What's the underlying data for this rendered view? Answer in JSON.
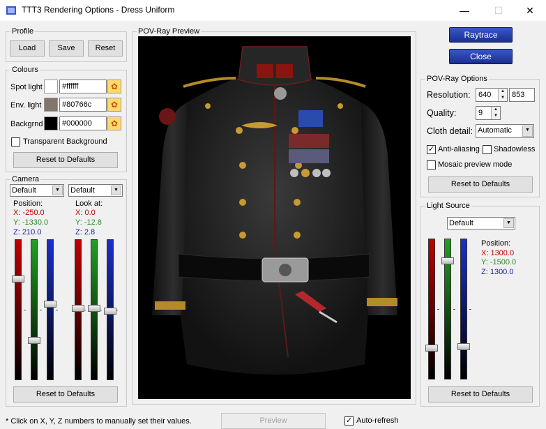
{
  "window": {
    "title": "TTT3 Rendering Options - Dress Uniform",
    "minimize": "—",
    "maximize": "☐",
    "close": "✕"
  },
  "profile": {
    "title": "Profile",
    "load": "Load",
    "save": "Save",
    "reset": "Reset"
  },
  "colours": {
    "title": "Colours",
    "rows": [
      {
        "label": "Spot light",
        "hex": "#ffffff",
        "color": "#ffffff"
      },
      {
        "label": "Env. light",
        "hex": "#80766c",
        "color": "#80766c"
      },
      {
        "label": "Backgrnd",
        "hex": "#000000",
        "color": "#000000"
      }
    ],
    "transparent_label": "Transparent Background",
    "reset": "Reset to Defaults"
  },
  "camera": {
    "title": "Camera",
    "preset1": "Default",
    "preset2": "Default",
    "position_label": "Position:",
    "look_label": "Look at:",
    "pos": {
      "x": "X:  -250.0",
      "y": "Y:  -1330.0",
      "z": "Z:  210.0"
    },
    "look": {
      "x": "X:  0.0",
      "y": "Y:  -12.8",
      "z": "Z:  2.8"
    },
    "reset": "Reset to Defaults"
  },
  "preview": {
    "title": "POV-Ray Preview"
  },
  "actions": {
    "raytrace": "Raytrace",
    "close": "Close"
  },
  "povray": {
    "title": "POV-Ray Options",
    "resolution_label": "Resolution:",
    "res_w": "640",
    "res_h": "853",
    "quality_label": "Quality:",
    "quality": "9",
    "cloth_label": "Cloth detail:",
    "cloth": "Automatic",
    "antialias": "Anti-aliasing",
    "shadowless": "Shadowless",
    "mosaic": "Mosaic preview mode",
    "reset": "Reset to Defaults"
  },
  "light": {
    "title": "Light Source",
    "preset": "Default",
    "position_label": "Position:",
    "x": "X:  1300.0",
    "y": "Y:  -1500.0",
    "z": "Z:  1300.0",
    "reset": "Reset to Defaults"
  },
  "footer": {
    "hint": "* Click on X, Y, Z numbers to manually set their values.",
    "preview": "Preview",
    "autorefresh": "Auto-refresh"
  },
  "sliders": {
    "camera_position": [
      0.27,
      0.73,
      0.46
    ],
    "camera_lookat": [
      0.49,
      0.49,
      0.51
    ],
    "light": [
      0.79,
      0.14,
      0.78
    ]
  },
  "colors": {
    "accent_blue": "#1f3596"
  }
}
